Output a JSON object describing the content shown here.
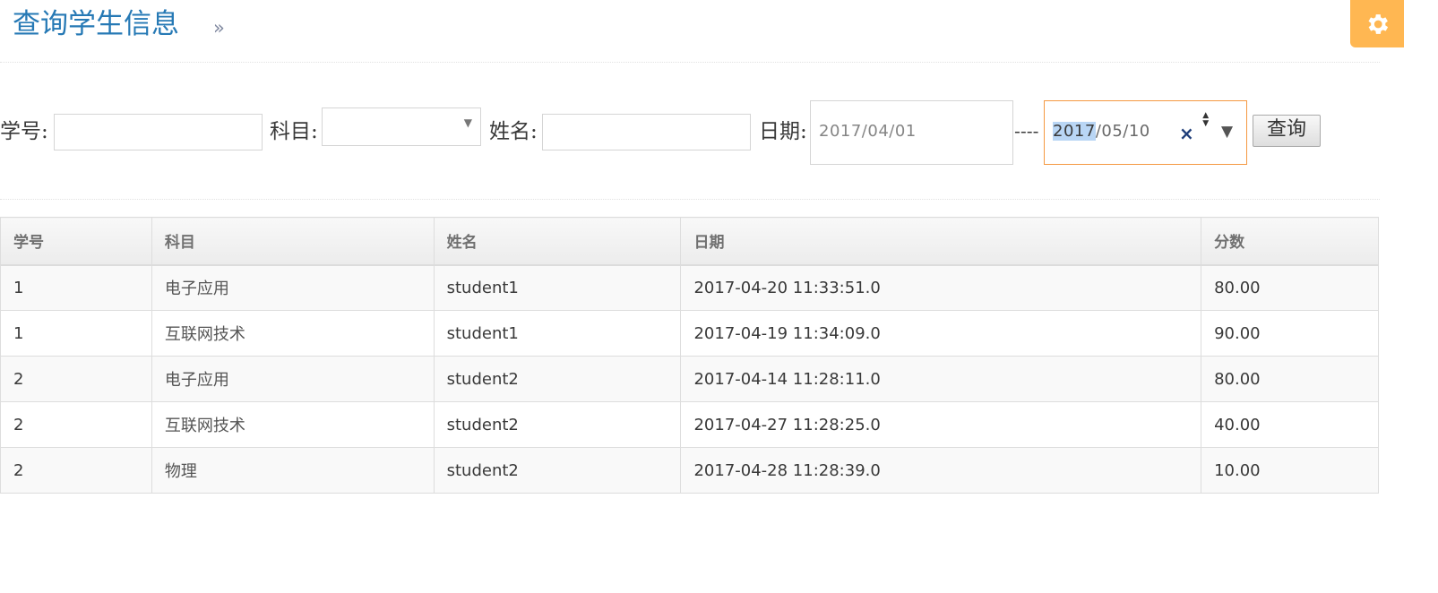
{
  "header": {
    "title": "查询学生信息",
    "arrow": "»",
    "settings_icon": "gear-icon"
  },
  "search": {
    "student_id_label": "学号:",
    "student_id_value": "",
    "subject_label": "科目:",
    "subject_selected": "",
    "name_label": "姓名:",
    "name_value": "",
    "date_label": "日期:",
    "date_start": "2017/04/01",
    "date_separator": "----",
    "date_end_year": "2017",
    "date_end_rest": "/05/10",
    "submit_label": "查询"
  },
  "table": {
    "headers": [
      "学号",
      "科目",
      "姓名",
      "日期",
      "分数"
    ],
    "rows": [
      [
        "1",
        "电子应用",
        "student1",
        "2017-04-20 11:33:51.0",
        "80.00"
      ],
      [
        "1",
        "互联网技术",
        "student1",
        "2017-04-19 11:34:09.0",
        "90.00"
      ],
      [
        "2",
        "电子应用",
        "student2",
        "2017-04-14 11:28:11.0",
        "80.00"
      ],
      [
        "2",
        "互联网技术",
        "student2",
        "2017-04-27 11:28:25.0",
        "40.00"
      ],
      [
        "2",
        "物理",
        "student2",
        "2017-04-28 11:28:39.0",
        "10.00"
      ]
    ]
  },
  "colors": {
    "title": "#2679b5",
    "settings_bg": "#ffb752",
    "focus_border": "#f59942"
  }
}
